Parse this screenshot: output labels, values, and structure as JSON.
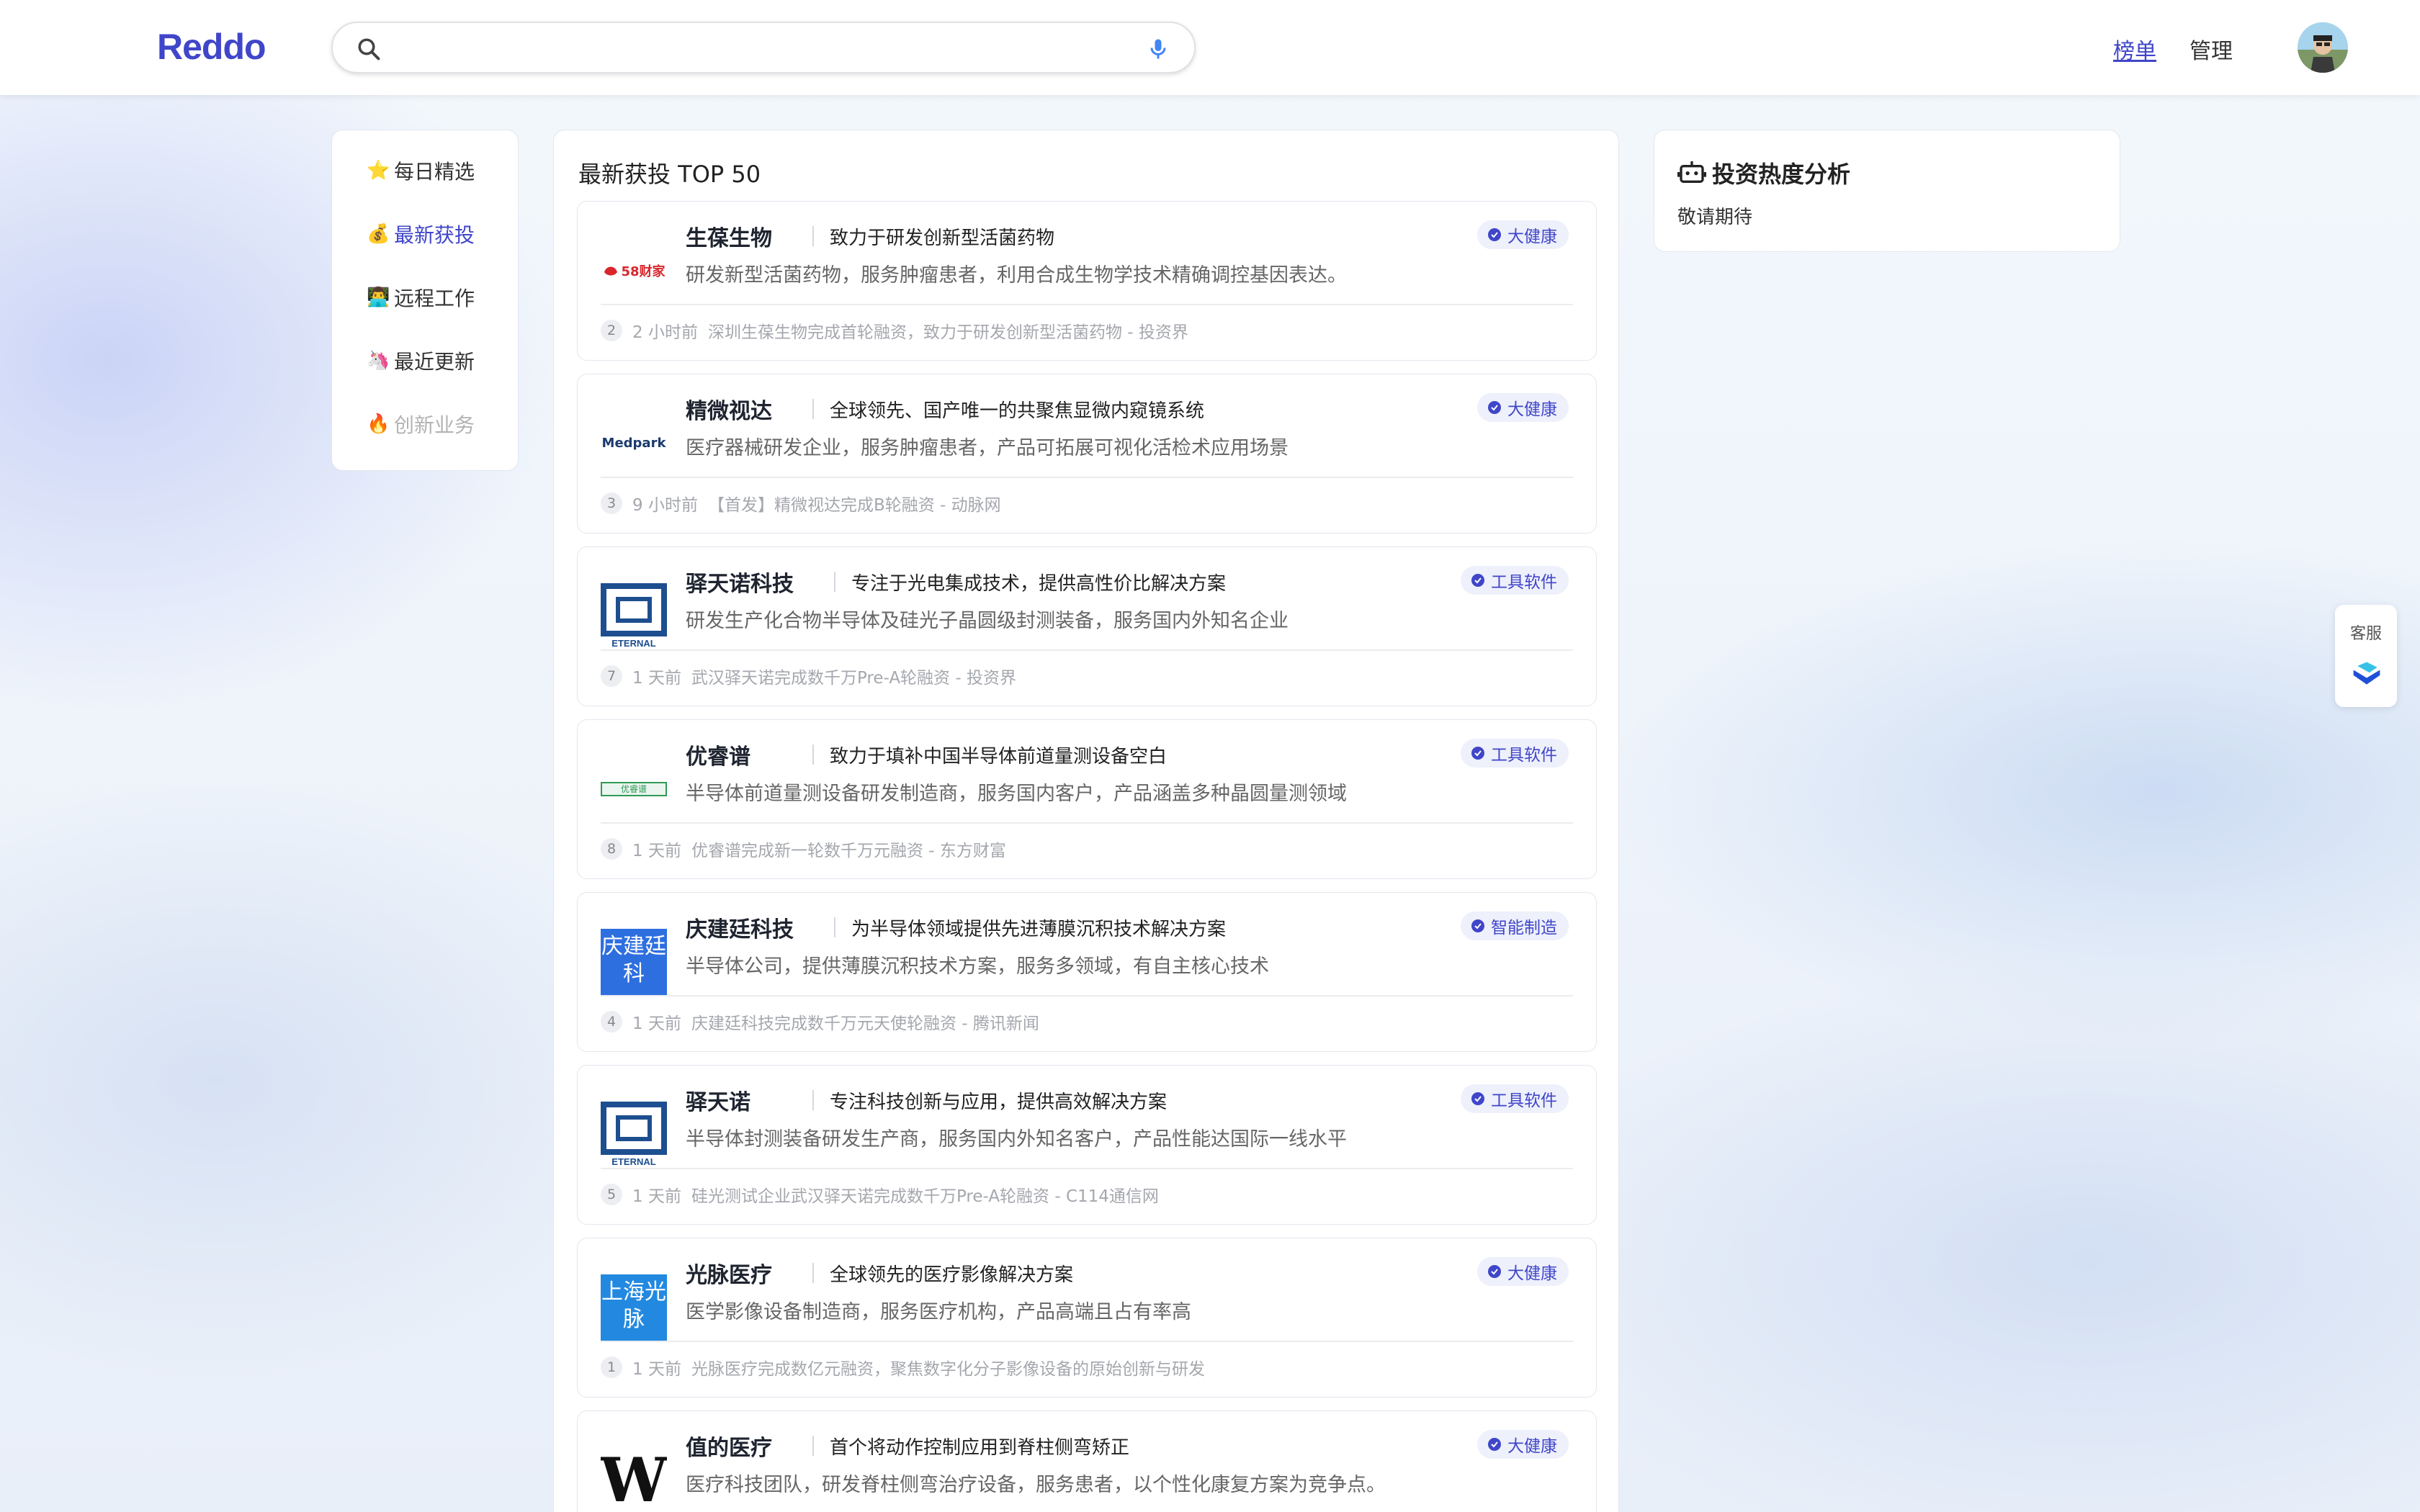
{
  "header": {
    "logo": "Reddo",
    "search": {
      "value": "",
      "placeholder": ""
    },
    "nav": {
      "rank": "榜单",
      "manage": "管理"
    }
  },
  "sidebar": {
    "items": [
      {
        "emoji": "⭐",
        "label": "每日精选",
        "state": "normal"
      },
      {
        "emoji": "💰",
        "label": "最新获投",
        "state": "active"
      },
      {
        "emoji": "👨‍💻",
        "label": "远程工作",
        "state": "normal"
      },
      {
        "emoji": "🦄",
        "label": "最近更新",
        "state": "normal"
      },
      {
        "emoji": "🔥",
        "label": "创新业务",
        "state": "disabled"
      }
    ]
  },
  "main": {
    "title": "最新获投 TOP 50",
    "items": [
      {
        "name": "生葆生物",
        "slogan": "致力于研发创新型活菌药物",
        "desc": "研发新型活菌药物，服务肿瘤患者，利用合成生物学技术精确调控基因表达。",
        "tag": "大健康",
        "rank": "2",
        "time": "2 小时前",
        "news": "深圳生葆生物完成首轮融资，致力于研发创新型活菌药物 - 投资界",
        "logo_text": "58财家"
      },
      {
        "name": "精微视达",
        "slogan": "全球领先、国产唯一的共聚焦显微内窥镜系统",
        "desc": "医疗器械研发企业，服务肿瘤患者，产品可拓展可视化活检术应用场景",
        "tag": "大健康",
        "rank": "3",
        "time": "9 小时前",
        "news": "【首发】精微视达完成B轮融资 - 动脉网",
        "logo_text": "Medpark"
      },
      {
        "name": "驿天诺科技",
        "slogan": "专注于光电集成技术，提供高性价比解决方案",
        "desc": "研发生产化合物半导体及硅光子晶圆级封测装备，服务国内外知名企业",
        "tag": "工具软件",
        "rank": "7",
        "time": "1 天前",
        "news": "武汉驿天诺完成数千万Pre-A轮融资 - 投资界",
        "logo_text": "ETERNAL"
      },
      {
        "name": "优睿谱",
        "slogan": "致力于填补中国半导体前道量测设备空白",
        "desc": "半导体前道量测设备研发制造商，服务国内客户，产品涵盖多种晶圆量测领域",
        "tag": "工具软件",
        "rank": "8",
        "time": "1 天前",
        "news": "优睿谱完成新一轮数千万元融资 - 东方财富",
        "logo_text": "优睿谱"
      },
      {
        "name": "庆建廷科技",
        "slogan": "为半导体领域提供先进薄膜沉积技术解决方案",
        "desc": "半导体公司，提供薄膜沉积技术方案，服务多领域，有自主核心技术",
        "tag": "智能制造",
        "rank": "4",
        "time": "1 天前",
        "news": "庆建廷科技完成数千万元天使轮融资 - 腾讯新闻",
        "logo_text": "庆建廷科"
      },
      {
        "name": "驿天诺",
        "slogan": "专注科技创新与应用，提供高效解决方案",
        "desc": "半导体封测装备研发生产商，服务国内外知名客户，产品性能达国际一线水平",
        "tag": "工具软件",
        "rank": "5",
        "time": "1 天前",
        "news": "硅光测试企业武汉驿天诺完成数千万Pre-A轮融资 - C114通信网",
        "logo_text": "ETERNAL"
      },
      {
        "name": "光脉医疗",
        "slogan": "全球领先的医疗影像解决方案",
        "desc": "医学影像设备制造商，服务医疗机构，产品高端且占有率高",
        "tag": "大健康",
        "rank": "1",
        "time": "1 天前",
        "news": "光脉医疗完成数亿元融资，聚焦数字化分子影像设备的原始创新与研发",
        "logo_text": "上海光脉"
      },
      {
        "name": "值的医疗",
        "slogan": "首个将动作控制应用到脊柱侧弯矫正",
        "desc": "医疗科技团队，研发脊柱侧弯治疗设备，服务患者，以个性化康复方案为竞争点。",
        "tag": "大健康",
        "rank": "",
        "time": "",
        "news": "",
        "logo_text": "W"
      }
    ]
  },
  "side_card": {
    "title": "投资热度分析",
    "subtitle": "敬请期待"
  },
  "cs": {
    "label": "客服"
  },
  "colors": {
    "accent": "#4046c9",
    "tag_bg": "#eef0fb"
  },
  "icons": {
    "search": "search-icon",
    "mic": "mic-icon",
    "robot": "robot-icon",
    "badge": "verified-badge-icon"
  }
}
